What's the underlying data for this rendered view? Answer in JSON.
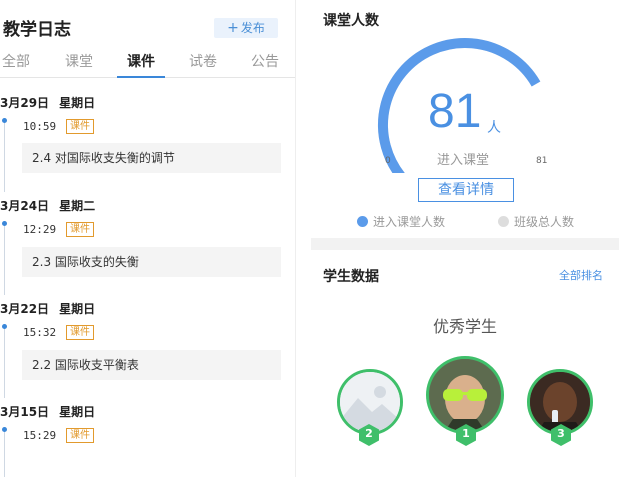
{
  "journal": {
    "title": "教学日志",
    "publish_label": "发布",
    "publish_icon": "plus-icon",
    "tabs": [
      {
        "label": "全部",
        "active": false
      },
      {
        "label": "课堂",
        "active": false
      },
      {
        "label": "课件",
        "active": true
      },
      {
        "label": "试卷",
        "active": false
      },
      {
        "label": "公告",
        "active": false
      }
    ],
    "days": [
      {
        "date": "3月29日",
        "weekday": "星期日",
        "time": "10:59",
        "tag": "课件",
        "title": "2.4 对国际收支失衡的调节"
      },
      {
        "date": "3月24日",
        "weekday": "星期二",
        "time": "12:29",
        "tag": "课件",
        "title": "2.3 国际收支的失衡"
      },
      {
        "date": "3月22日",
        "weekday": "星期日",
        "time": "15:32",
        "tag": "课件",
        "title": "2.2 国际收支平衡表"
      },
      {
        "date": "3月15日",
        "weekday": "星期日",
        "time": "15:29",
        "tag": "课件",
        "title": ""
      }
    ]
  },
  "attendance": {
    "title": "课堂人数",
    "count": "81",
    "unit": "人",
    "label": "进入课堂",
    "min": "0",
    "max": "81",
    "fill_fraction": 1.0,
    "detail_button": "查看详情",
    "legend": [
      {
        "label": "进入课堂人数",
        "color": "#5b9bea"
      },
      {
        "label": "班级总人数",
        "color": "#dddddd"
      }
    ],
    "accent_color": "#5b9bea"
  },
  "students": {
    "title": "学生数据",
    "all_rank_link": "全部排名",
    "excellent_label": "优秀学生",
    "top": [
      {
        "rank": "2",
        "avatar": "placeholder-image-icon"
      },
      {
        "rank": "1",
        "avatar": "student-photo"
      },
      {
        "rank": "3",
        "avatar": "student-photo"
      }
    ],
    "badge_color": "#3fbf6a"
  }
}
